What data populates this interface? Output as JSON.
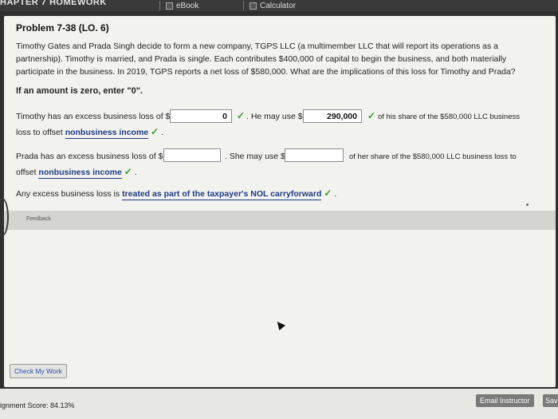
{
  "topbar": {
    "chapter": "HAPTER 7 HOMEWORK",
    "ebook_label": "eBook",
    "calculator_label": "Calculator"
  },
  "problem": {
    "title": "Problem 7-38 (LO. 6)",
    "text": "Timothy Gates and Prada Singh decide to form a new company, TGPS LLC (a multimember LLC that will report its operations as a partnership). Timothy is married, and Prada is single. Each contributes $400,000 of capital to begin the business, and both materially participate in the business. In 2019, TGPS reports a net loss of $580,000. What are the implications of this loss for Timothy and Prada?",
    "zero_note": "If an amount is zero, enter \"0\"."
  },
  "timothy": {
    "pre": "Timothy has an excess business loss of $",
    "excess_value": "0",
    "mid": ". He may use $",
    "use_value": "290,000",
    "post": "of his share of the $580,000 LLC business",
    "line2_pre": "loss to offset",
    "selection": "nonbusiness income"
  },
  "prada": {
    "pre": "Prada has an excess business loss of $",
    "excess_value": "",
    "mid": ". She may use $",
    "use_value": "",
    "post": "of her share of the $580,000 LLC business loss to",
    "line2_pre": "offset",
    "selection": "nonbusiness income"
  },
  "excess": {
    "pre": "Any excess business loss is",
    "selection": "treated as part of the taxpayer's NOL carryforward"
  },
  "feedback_label": "Feedback",
  "check_button": "Check My Work",
  "score": "ignment Score: 84.13%",
  "email_button": "Email Instructor",
  "save_button": "Save"
}
